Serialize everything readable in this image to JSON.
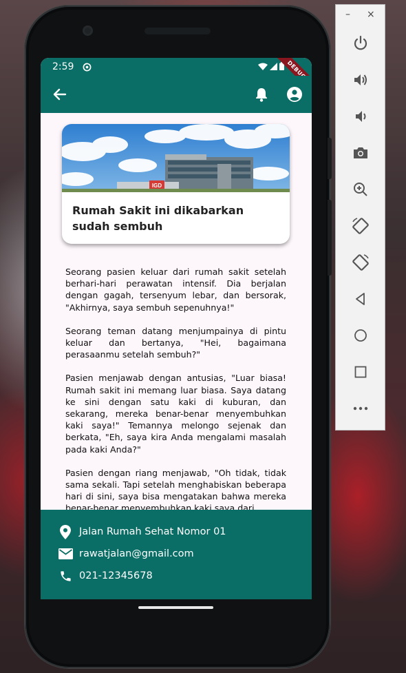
{
  "status_bar": {
    "time": "2:59",
    "debug_label": "DEBUG"
  },
  "app_bar": {
    "back_icon": "arrow-back-icon",
    "notification_icon": "bell-icon",
    "profile_icon": "account-circle-icon"
  },
  "card": {
    "image_label": "IGD",
    "title": "Rumah Sakit ini dikabarkan sudah sembuh"
  },
  "article": {
    "paragraphs": [
      "Seorang pasien keluar dari rumah sakit setelah berhari-hari perawatan intensif. Dia berjalan dengan gagah, tersenyum lebar, dan bersorak, \"Akhirnya, saya sembuh sepenuhnya!\"",
      "Seorang teman datang menjumpainya di pintu keluar dan bertanya, \"Hei, bagaimana perasaanmu setelah sembuh?\"",
      "Pasien menjawab dengan antusias, \"Luar biasa! Rumah sakit ini memang luar biasa. Saya datang ke sini dengan satu kaki di kuburan, dan sekarang, mereka benar-benar menyembuhkan kaki saya!\" Temannya melongo sejenak dan berkata, \"Eh, saya kira Anda mengalami masalah pada kaki Anda?\"",
      "Pasien dengan riang menjawab, \"Oh tidak, tidak sama sekali. Tapi setelah menghabiskan beberapa hari di sini, saya bisa mengatakan bahwa mereka benar-benar menyembuhkan kaki saya dari"
    ]
  },
  "footer": {
    "address": "Jalan Rumah Sehat Nomor 01",
    "email": "rawatjalan@gmail.com",
    "phone": "021-12345678"
  },
  "emulator": {
    "window_controls": {
      "minimize": "–",
      "close": "×"
    },
    "tools": [
      "power-icon",
      "volume-up-icon",
      "volume-down-icon",
      "camera-icon",
      "zoom-in-icon",
      "rotate-left-icon",
      "rotate-right-icon",
      "back-icon",
      "home-icon",
      "overview-icon",
      "more-icon"
    ]
  },
  "colors": {
    "primary": "#0b6e66",
    "screen_bg": "#fdf7fb",
    "debug_ribbon": "#8a1620"
  }
}
